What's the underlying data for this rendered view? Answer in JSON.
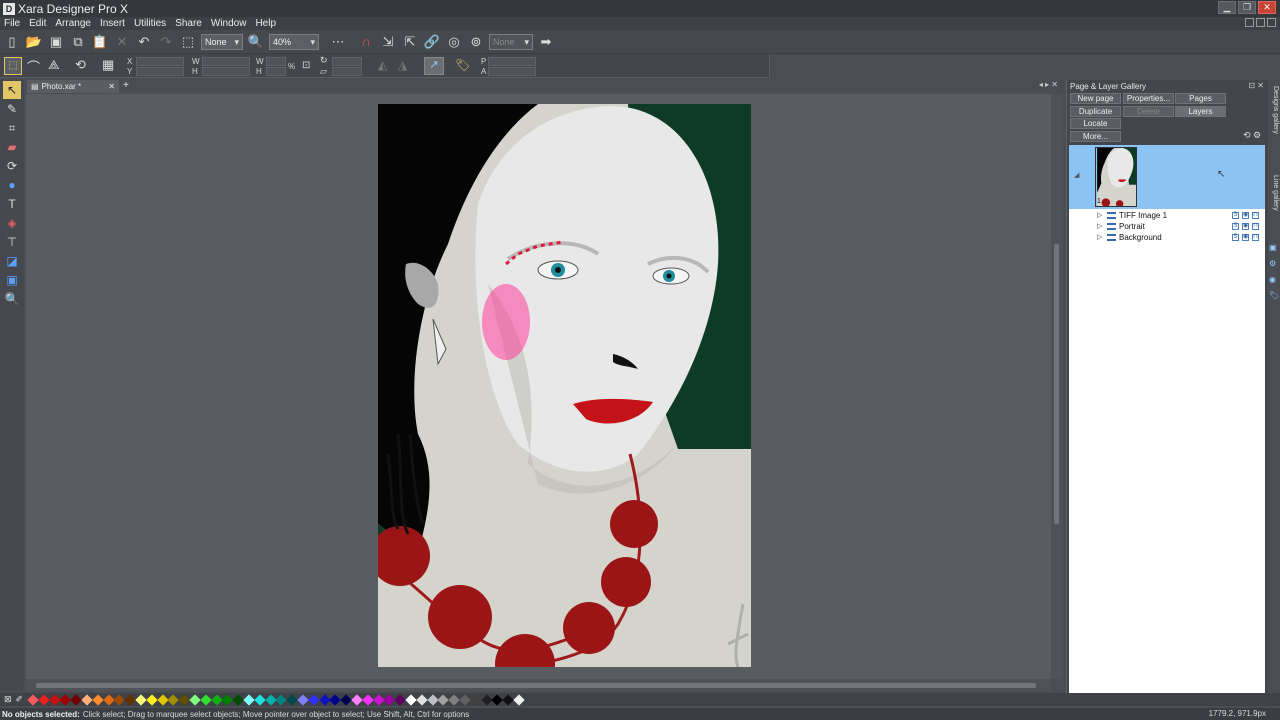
{
  "window": {
    "icon_letter": "D",
    "title": "Xara Designer Pro X"
  },
  "menu": [
    "File",
    "Edit",
    "Arrange",
    "Insert",
    "Utilities",
    "Share",
    "Window",
    "Help"
  ],
  "toolbar": {
    "quality_value": "None",
    "zoom_value": "40%",
    "disabled_field": "None"
  },
  "infobar": {
    "x_label": "X",
    "y_label": "Y",
    "w_label": "W",
    "h_label": "H",
    "lock_label": "%",
    "p_label": "P",
    "a_label": "A"
  },
  "document": {
    "tab_label": "Photo.xar *",
    "add_tab": "+"
  },
  "gallery": {
    "title": "Page & Layer Gallery",
    "buttons": {
      "new_page": "New page",
      "properties": "Properties...",
      "pages": "Pages",
      "duplicate": "Duplicate",
      "delete": "Delete",
      "layers": "Layers",
      "locate": "Locate",
      "more": "More..."
    },
    "page_number": "1",
    "layers": [
      {
        "name": "TIFF Image 1"
      },
      {
        "name": "Portrait"
      },
      {
        "name": "Background"
      }
    ]
  },
  "side_tabs": [
    "Designs gallery",
    "Line gallery"
  ],
  "status": {
    "bold": "No objects selected:",
    "text": "Click select; Drag to marquee select objects; Move pointer over object to select; Use Shift, Alt, Ctrl for options",
    "coords": "1779.2, 971.9px"
  },
  "colors": {
    "palette": [
      "#ff5a5a",
      "#e82020",
      "#c81010",
      "#a00000",
      "#700000",
      "#ffb07a",
      "#ff8a2a",
      "#e06a10",
      "#a04a00",
      "#603000",
      "#ffff80",
      "#ffee20",
      "#e0c800",
      "#a09000",
      "#605000",
      "#80ff80",
      "#30e030",
      "#10b010",
      "#008000",
      "#004a00",
      "#80ffff",
      "#20e0e0",
      "#00b0b0",
      "#008080",
      "#004848",
      "#8080ff",
      "#3030ff",
      "#1010c0",
      "#000090",
      "#000050",
      "#ff80ff",
      "#ff30ff",
      "#d010d0",
      "#a000a0",
      "#600060",
      "#ffffff",
      "#e0e0e0",
      "#c0c0c0",
      "#a0a0a0",
      "#808080",
      "#606060",
      "#404040",
      "#202020",
      "#000000",
      "#111111",
      "#f0f0f0"
    ],
    "selection_blue": "#8cc3f5",
    "active_tool": "#e2c66a"
  }
}
